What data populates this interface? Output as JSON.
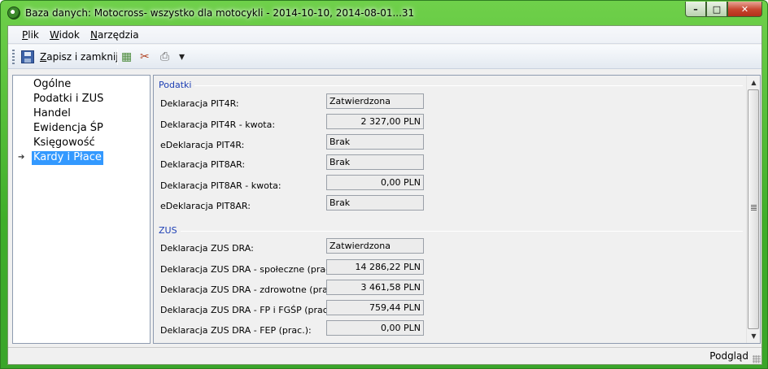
{
  "window": {
    "title": "Baza danych: Motocross- wszystko dla motocykli - 2014-10-10, 2014-08-01...31",
    "controls": {
      "minimize": "–",
      "maximize": "□",
      "close": "✕"
    }
  },
  "menu": {
    "items": [
      {
        "label": "Plik",
        "mnemonic": "P",
        "rest": "lik"
      },
      {
        "label": "Widok",
        "mnemonic": "W",
        "rest": "idok"
      },
      {
        "label": "Narzędzia",
        "mnemonic": "N",
        "rest": "arzędzia"
      }
    ]
  },
  "toolbar": {
    "save_mnemonic": "Z",
    "save_rest": "apisz i zamknij",
    "save_label": "Zapisz i zamknij",
    "icons": {
      "grid": "▦",
      "tools": "✂",
      "print": "⎙",
      "dropdown": "▾"
    }
  },
  "nav": {
    "items": [
      {
        "label": "Ogólne"
      },
      {
        "label": "Podatki i ZUS"
      },
      {
        "label": "Handel"
      },
      {
        "label": "Ewidencja ŚP"
      },
      {
        "label": "Księgowość"
      },
      {
        "label": "Kardy i Płace",
        "selected": true
      }
    ],
    "arrow": "➔"
  },
  "podatki": {
    "title": "Podatki",
    "rows": [
      {
        "label": "Deklaracja PIT4R:",
        "value": "Zatwierdzona"
      },
      {
        "label": "Deklaracja PIT4R - kwota:",
        "value": "2 327,00 PLN"
      },
      {
        "label": "eDeklaracja PIT4R:",
        "value": "Brak"
      },
      {
        "label": "Deklaracja PIT8AR:",
        "value": "Brak"
      },
      {
        "label": "Deklaracja PIT8AR - kwota:",
        "value": "0,00 PLN"
      },
      {
        "label": "eDeklaracja PIT8AR:",
        "value": "Brak"
      }
    ]
  },
  "zus": {
    "title": "ZUS",
    "rows": [
      {
        "label": "Deklaracja ZUS DRA:",
        "value": "Zatwierdzona"
      },
      {
        "label": "Deklaracja ZUS DRA - społeczne (prac.):",
        "value": "14 286,22 PLN"
      },
      {
        "label": "Deklaracja ZUS DRA - zdrowotne (prac.):",
        "value": "3 461,58 PLN"
      },
      {
        "label": "Deklaracja ZUS DRA - FP i FGŚP (prac.)",
        "value": "759,44 PLN"
      },
      {
        "label": "Deklaracja ZUS DRA - FEP (prac.):",
        "value": "0,00 PLN"
      }
    ]
  },
  "scrollbar": {
    "up": "▲",
    "down": "▼"
  },
  "status": {
    "mode": "Podgląd"
  }
}
